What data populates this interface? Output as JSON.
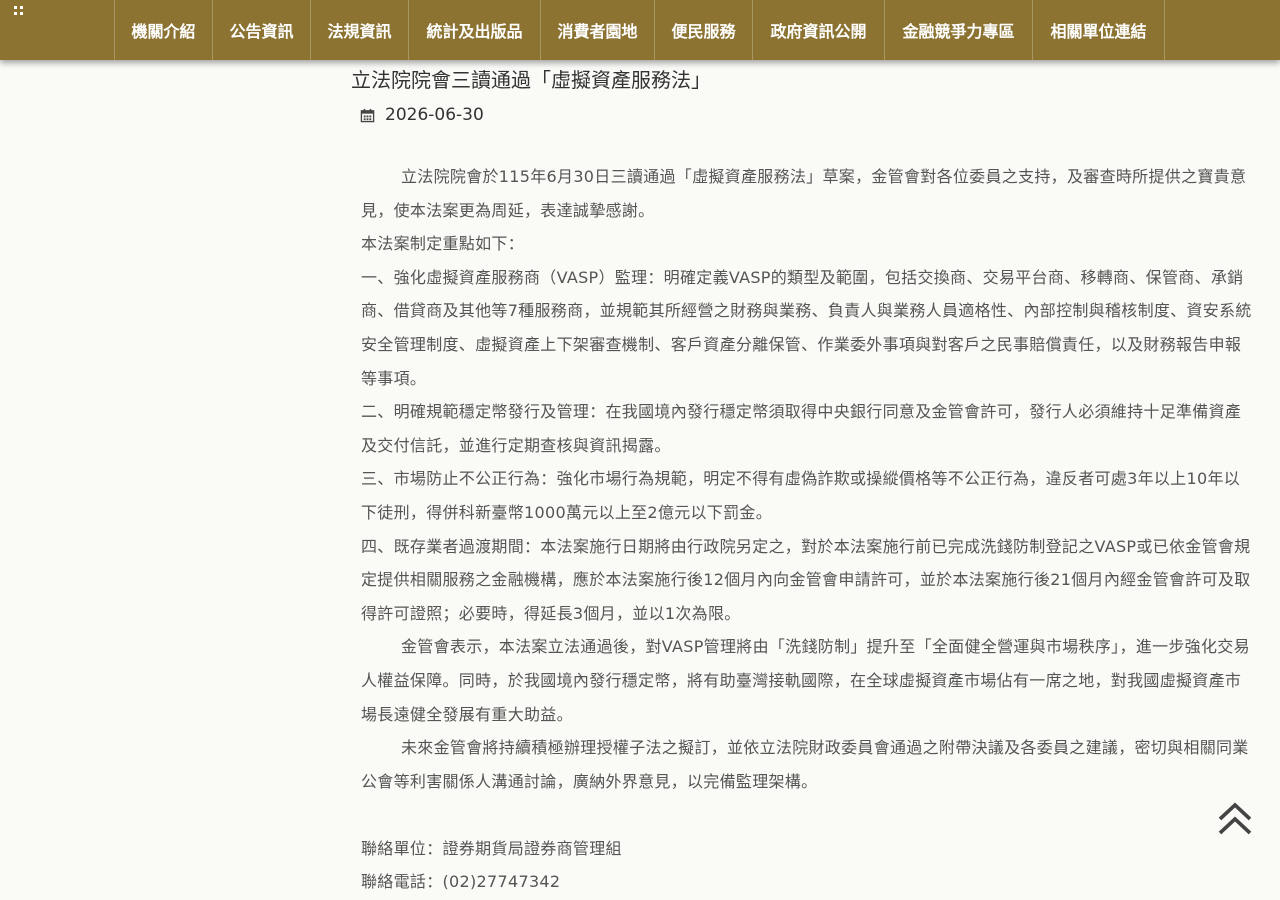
{
  "nav": {
    "items": [
      {
        "label": "機關介紹",
        "width": 98
      },
      {
        "label": "公告資訊",
        "width": 98
      },
      {
        "label": "法規資訊",
        "width": 98
      },
      {
        "label": "統計及出版品",
        "width": 132
      },
      {
        "label": "消費者園地",
        "width": 114
      },
      {
        "label": "便民服務",
        "width": 98
      },
      {
        "label": "政府資訊公開",
        "width": 132
      },
      {
        "label": "金融競爭力專區",
        "width": 148
      },
      {
        "label": "相關單位連結",
        "width": 132
      }
    ]
  },
  "article": {
    "title": "立法院院會三讀通過「虛擬資產服務法」",
    "date": "2026-06-30",
    "paragraphs": [
      "立法院院會於115年6月30日三讀通過「虛擬資產服務法」草案，金管會對各位委員之支持，及審查時所提供之寶貴意見，使本法案更為周延，表達誠摯感謝。",
      "本法案制定重點如下：",
      "一、強化虛擬資產服務商（VASP）監理：明確定義VASP的類型及範圍，包括交換商、交易平台商、移轉商、保管商、承銷商、借貸商及其他等7種服務商，並規範其所經營之財務與業務、負責人與業務人員適格性、內部控制與稽核制度、資安系統安全管理制度、虛擬資產上下架審查機制、客戶資產分離保管、作業委外事項與對客戶之民事賠償責任，以及財務報告申報等事項。",
      "二、明確規範穩定幣發行及管理：在我國境內發行穩定幣須取得中央銀行同意及金管會許可，發行人必須維持十足準備資產及交付信託，並進行定期查核與資訊揭露。",
      "三、市場防止不公正行為：強化市場行為規範，明定不得有虛偽詐欺或操縱價格等不公正行為，違反者可處3年以上10年以下徒刑，得併科新臺幣1000萬元以上至2億元以下罰金。",
      "四、既存業者過渡期間：本法案施行日期將由行政院另定之，對於本法案施行前已完成洗錢防制登記之VASP或已依金管會規定提供相關服務之金融機構，應於本法案施行後12個月內向金管會申請許可，並於本法案施行後21個月內經金管會許可及取得許可證照；必要時，得延長3個月，並以1次為限。",
      "金管會表示，本法案立法通過後，對VASP管理將由「洗錢防制」提升至「全面健全營運與市場秩序」，進一步強化交易人權益保障。同時，於我國境內發行穩定幣，將有助臺灣接軌國際，在全球虛擬資產市場佔有一席之地，對我國虛擬資產市場長遠健全發展有重大助益。",
      "未來金管會將持續積極辦理授權子法之擬訂，並依立法院財政委員會通過之附帶決議及各委員之建議，密切與相關同業公會等利害關係人溝通討論，廣納外界意見，以完備監理架構。"
    ],
    "contact_unit": "聯絡單位：證券期貨局證券商管理組",
    "contact_phone": "聯絡電話：(02)27747342"
  }
}
